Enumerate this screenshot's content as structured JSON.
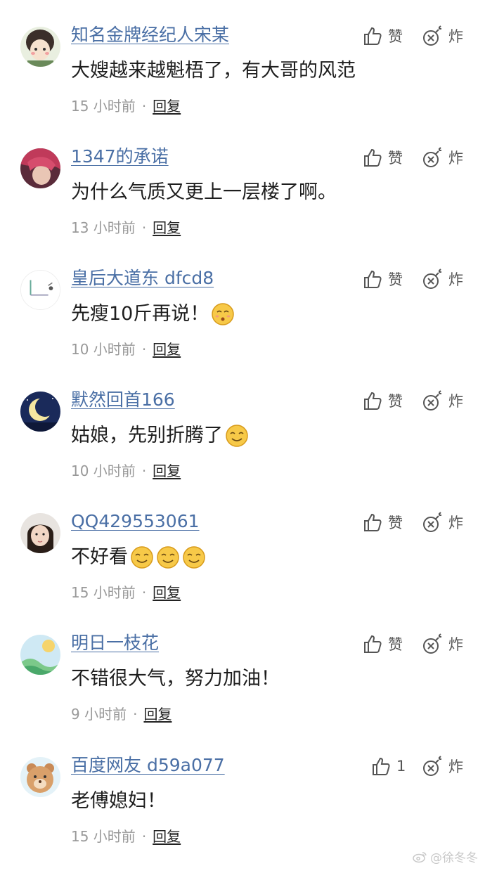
{
  "colors": {
    "username": "#4a6fa5",
    "meta": "#999999",
    "text": "#1e1e1e",
    "icon": "#555555"
  },
  "comments": [
    {
      "username": "知名金牌经纪人宋某",
      "text": "大嫂越来越魁梧了，有大哥的风范",
      "time": "15 小时前",
      "reply": "回复",
      "like": "赞",
      "bomb": "炸",
      "emojis": []
    },
    {
      "username": "1347的承诺",
      "text": "为什么气质又更上一层楼了啊。",
      "time": "13 小时前",
      "reply": "回复",
      "like": "赞",
      "bomb": "炸",
      "emojis": []
    },
    {
      "username": "皇后大道东 dfcd8",
      "text": "先瘦10斤再说！",
      "time": "10 小时前",
      "reply": "回复",
      "like": "赞",
      "bomb": "炸",
      "emojis": [
        "whistle-emoji"
      ]
    },
    {
      "username": "默然回首166",
      "text": "姑娘，先别折腾了",
      "time": "10 小时前",
      "reply": "回复",
      "like": "赞",
      "bomb": "炸",
      "emojis": [
        "smile-emoji"
      ]
    },
    {
      "username": "QQ429553061",
      "text": "不好看",
      "time": "15 小时前",
      "reply": "回复",
      "like": "赞",
      "bomb": "炸",
      "emojis": [
        "smile-emoji",
        "smile-emoji",
        "smile-emoji"
      ]
    },
    {
      "username": "明日一枝花",
      "text": "不错很大气，努力加油！",
      "time": "9 小时前",
      "reply": "回复",
      "like": "赞",
      "bomb": "炸",
      "emojis": []
    },
    {
      "username": "百度网友 d59a077",
      "text": "老傅媳妇！",
      "time": "15 小时前",
      "reply": "回复",
      "like": "1",
      "bomb": "炸",
      "emojis": []
    }
  ],
  "watermark": "@徐冬冬"
}
